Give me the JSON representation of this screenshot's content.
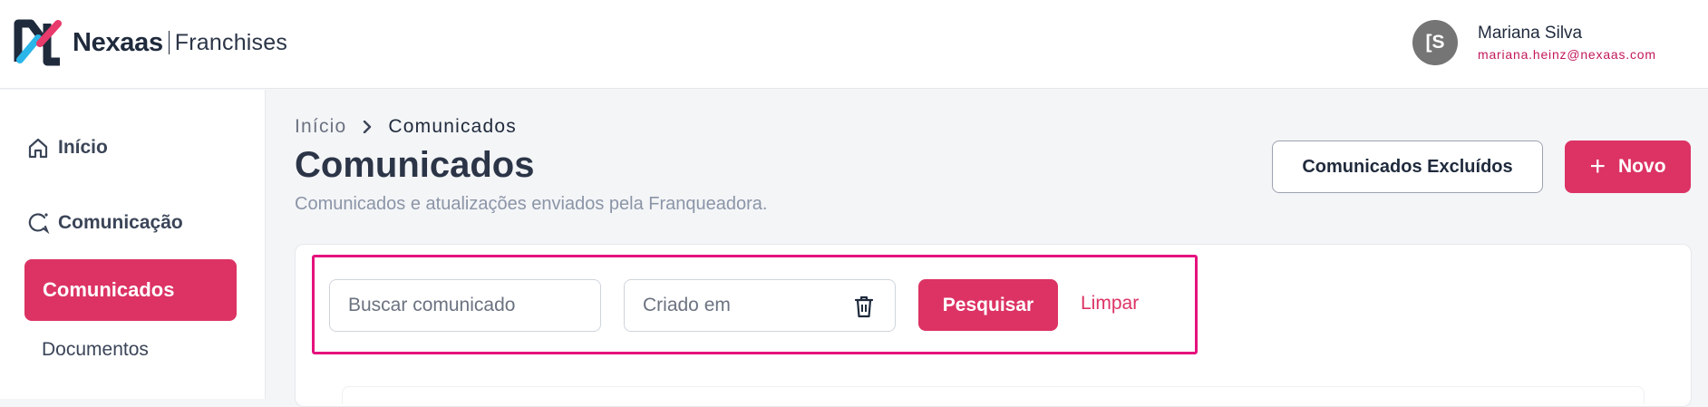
{
  "header": {
    "brand": "Nexaas",
    "brand_sub": "Franchises",
    "user": {
      "avatar_initials": "[S",
      "name": "Mariana Silva",
      "email": "mariana.heinz@nexaas.com"
    }
  },
  "sidebar": {
    "items": [
      {
        "label": "Início",
        "icon": "home-icon"
      },
      {
        "label": "Comunicação",
        "icon": "chat-icon"
      },
      {
        "label": "Comunicados",
        "active": true
      },
      {
        "label": "Documentos"
      }
    ]
  },
  "breadcrumb": {
    "home": "Início",
    "current": "Comunicados"
  },
  "page": {
    "title": "Comunicados",
    "subtitle": "Comunicados e atualizações enviados pela Franqueadora."
  },
  "actions": {
    "deleted_label": "Comunicados Excluídos",
    "new_label": "Novo"
  },
  "filters": {
    "search_placeholder": "Buscar comunicado",
    "date_placeholder": "Criado em",
    "search_button": "Pesquisar",
    "clear_link": "Limpar"
  },
  "colors": {
    "accent": "#dc3364",
    "highlight": "#e5127d",
    "text": "#1f2a3c",
    "muted": "#8b95a7"
  }
}
